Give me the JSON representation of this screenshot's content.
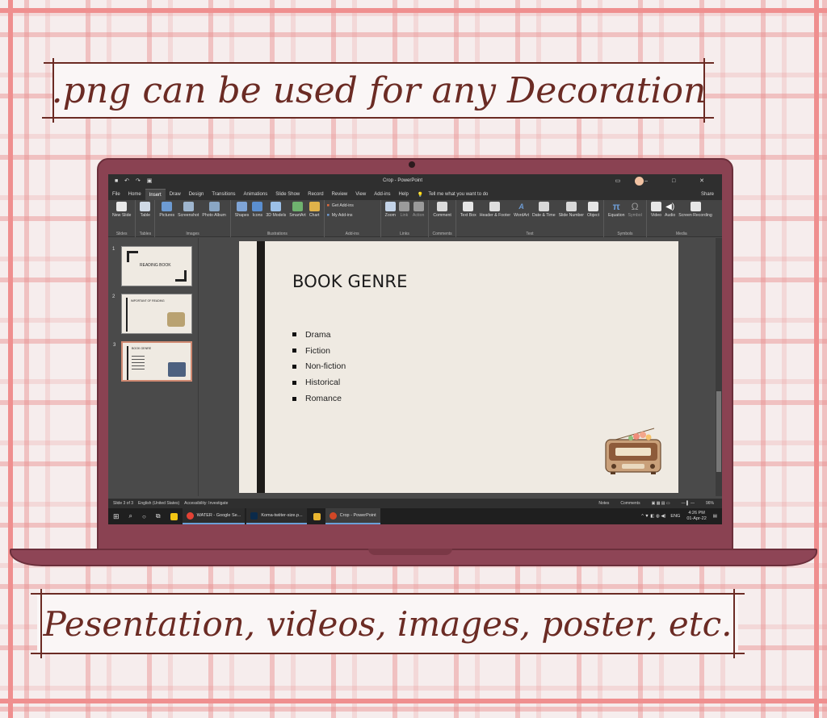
{
  "banners": {
    "top": ".png can be used for any Decoration",
    "bottom": "Pesentation, videos, images, poster, etc."
  },
  "window": {
    "title": "Crop - PowerPoint"
  },
  "menu": {
    "tabs": [
      "File",
      "Home",
      "Insert",
      "Draw",
      "Design",
      "Transitions",
      "Animations",
      "Slide Show",
      "Record",
      "Review",
      "View",
      "Add-ins",
      "Help"
    ],
    "active": "Insert",
    "tell": "Tell me what you want to do",
    "share": "Share"
  },
  "ribbon": {
    "groups": [
      {
        "name": "Slides",
        "items": [
          "New Slide"
        ]
      },
      {
        "name": "Tables",
        "items": [
          "Table"
        ]
      },
      {
        "name": "Images",
        "items": [
          "Pictures",
          "Screenshot",
          "Photo Album"
        ]
      },
      {
        "name": "Illustrations",
        "items": [
          "Shapes",
          "Icons",
          "3D Models",
          "SmartArt",
          "Chart"
        ]
      },
      {
        "name": "Add-ins",
        "items": [
          "Get Add-ins",
          "My Add-ins"
        ]
      },
      {
        "name": "Links",
        "items": [
          "Zoom",
          "Link",
          "Action"
        ]
      },
      {
        "name": "Comments",
        "items": [
          "Comment"
        ]
      },
      {
        "name": "Text",
        "items": [
          "Text Box",
          "Header & Footer",
          "WordArt",
          "Date & Time",
          "Slide Number",
          "Object"
        ]
      },
      {
        "name": "Symbols",
        "items": [
          "Equation",
          "Symbol"
        ]
      },
      {
        "name": "Media",
        "items": [
          "Video",
          "Audio",
          "Screen Recording"
        ]
      }
    ]
  },
  "thumbnails": [
    {
      "num": "1",
      "title": "READING BOOK"
    },
    {
      "num": "2",
      "title": "IMPORTANT OF READING"
    },
    {
      "num": "3",
      "title": "BOOK GENRE"
    }
  ],
  "slide": {
    "title": "BOOK GENRE",
    "bullets": [
      "Drama",
      "Fiction",
      "Non-fiction",
      "Historical",
      "Romance"
    ]
  },
  "status": {
    "slide": "Slide 3 of 3",
    "language": "English (United States)",
    "accessibility": "Accessibility: Investigate",
    "notes": "Notes",
    "comments": "Comments",
    "zoom": "96%"
  },
  "taskbar": {
    "apps": [
      "WATER - Google Se...",
      "Koma-twiiter-size.p...",
      "Crop - PowerPoint"
    ],
    "lang": "ENG",
    "time": "4:26 PM",
    "date": "01-Apr-22"
  },
  "colors": {
    "banner_text": "#6b2b24",
    "laptop": "#8a4252",
    "accent": "#d24726"
  }
}
